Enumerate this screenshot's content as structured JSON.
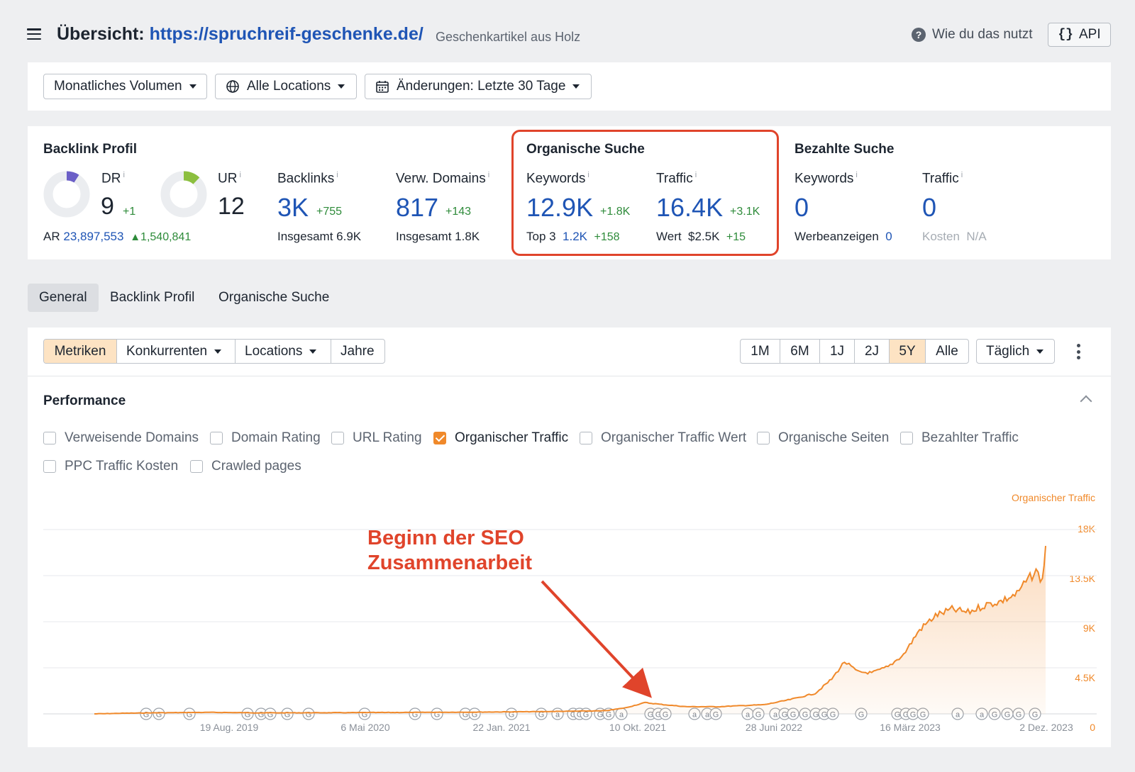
{
  "header": {
    "title_prefix": "Übersicht:",
    "title_url": "https://spruchreif-geschenke.de/",
    "subtitle": "Geschenkartikel aus Holz",
    "help_label": "Wie du das nutzt",
    "api_label": "API"
  },
  "filters": {
    "volume": "Monatliches Volumen",
    "locations": "Alle Locations",
    "changes": "Änderungen: Letzte 30 Tage"
  },
  "backlink_profile": {
    "title": "Backlink Profil",
    "dr": {
      "label": "DR",
      "value": "9",
      "delta": "+1",
      "fraction": 0.09
    },
    "ur": {
      "label": "UR",
      "value": "12",
      "fraction": 0.12
    },
    "ar": {
      "label": "AR",
      "value": "23,897,553",
      "delta": "1,540,841"
    },
    "backlinks": {
      "label": "Backlinks",
      "value": "3K",
      "delta": "+755",
      "total_label": "Insgesamt",
      "total": "6.9K"
    },
    "ref_domains": {
      "label": "Verw. Domains",
      "value": "817",
      "delta": "+143",
      "total_label": "Insgesamt",
      "total": "1.8K"
    }
  },
  "organic_search": {
    "title": "Organische Suche",
    "keywords": {
      "label": "Keywords",
      "value": "12.9K",
      "delta": "+1.8K",
      "sub_label": "Top 3",
      "sub_value": "1.2K",
      "sub_delta": "+158"
    },
    "traffic": {
      "label": "Traffic",
      "value": "16.4K",
      "delta": "+3.1K",
      "sub_label": "Wert",
      "sub_value": "$2.5K",
      "sub_delta": "+15"
    }
  },
  "paid_search": {
    "title": "Bezahlte Suche",
    "keywords": {
      "label": "Keywords",
      "value": "0",
      "sub_label": "Werbeanzeigen",
      "sub_value": "0"
    },
    "traffic": {
      "label": "Traffic",
      "value": "0",
      "sub_label": "Kosten",
      "sub_value": "N/A"
    }
  },
  "tabs": [
    "General",
    "Backlink Profil",
    "Organische Suche"
  ],
  "toolbar": {
    "metrics": "Metriken",
    "competitors": "Konkurrenten",
    "locations": "Locations",
    "years": "Jahre",
    "ranges": [
      "1M",
      "6M",
      "1J",
      "2J",
      "5Y",
      "Alle"
    ],
    "active_range": "5Y",
    "interval": "Täglich"
  },
  "performance": {
    "title": "Performance",
    "checkboxes": [
      {
        "label": "Verweisende Domains",
        "checked": false
      },
      {
        "label": "Domain Rating",
        "checked": false
      },
      {
        "label": "URL Rating",
        "checked": false
      },
      {
        "label": "Organischer Traffic",
        "checked": true
      },
      {
        "label": "Organischer Traffic Wert",
        "checked": false
      },
      {
        "label": "Organische Seiten",
        "checked": false
      },
      {
        "label": "Bezahlter Traffic",
        "checked": false
      },
      {
        "label": "PPC Traffic Kosten",
        "checked": false
      },
      {
        "label": "Crawled pages",
        "checked": false
      }
    ]
  },
  "annotation": {
    "line1": "Beginn der SEO",
    "line2": "Zusammenarbeit"
  },
  "colors": {
    "accent": "#f0892a",
    "link": "#1f55b5",
    "positive": "#2e8b3a",
    "highlight": "#e0442b",
    "dr_donut": "#6b5fc7",
    "ur_donut": "#8cbf3f"
  },
  "chart_data": {
    "type": "area",
    "series": [
      {
        "name": "Organischer Traffic"
      }
    ],
    "x": [
      "2019-01-15",
      "2019-03-01",
      "2019-05-01",
      "2019-08-19",
      "2019-12-01",
      "2020-05-06",
      "2020-10-01",
      "2021-01-22",
      "2021-05-01",
      "2021-09-01",
      "2021-10-10",
      "2021-11-15",
      "2021-12-20",
      "2022-02-01",
      "2022-04-01",
      "2022-06-28",
      "2022-08-15",
      "2022-10-01",
      "2022-11-01",
      "2022-11-25",
      "2022-12-20",
      "2023-01-15",
      "2023-02-15",
      "2023-03-16",
      "2023-04-15",
      "2023-05-15",
      "2023-06-15",
      "2023-07-15",
      "2023-08-15",
      "2023-09-15",
      "2023-10-15",
      "2023-11-01",
      "2023-11-20",
      "2023-12-02",
      "2023-12-05",
      "2023-12-08"
    ],
    "y": [
      0,
      50,
      100,
      150,
      100,
      120,
      150,
      180,
      220,
      300,
      600,
      1100,
      900,
      700,
      700,
      900,
      1400,
      2000,
      3400,
      5100,
      4100,
      4000,
      4600,
      5800,
      8200,
      9600,
      10200,
      9900,
      10600,
      11000,
      11700,
      12900,
      13900,
      13000,
      14700,
      16400
    ],
    "yticks": [
      "18K",
      "13.5K",
      "9K",
      "4.5K",
      "0"
    ],
    "ylim": [
      0,
      18000
    ],
    "xticks": [
      "19 Aug. 2019",
      "6 Mai 2020",
      "22 Jan. 2021",
      "10 Okt. 2021",
      "28 Juni 2022",
      "16 März 2023",
      "2 Dez. 2023"
    ],
    "grid": true,
    "legend": "top-right"
  }
}
